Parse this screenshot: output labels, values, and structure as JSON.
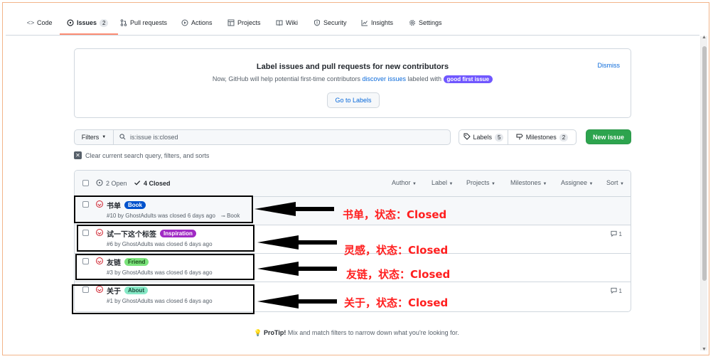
{
  "nav": {
    "tabs": [
      {
        "label": "Code",
        "icon": "code-icon"
      },
      {
        "label": "Issues",
        "icon": "issue-icon",
        "count": "2",
        "selected": true
      },
      {
        "label": "Pull requests",
        "icon": "pull-request-icon"
      },
      {
        "label": "Actions",
        "icon": "play-icon"
      },
      {
        "label": "Projects",
        "icon": "table-icon"
      },
      {
        "label": "Wiki",
        "icon": "book-icon"
      },
      {
        "label": "Security",
        "icon": "shield-icon"
      },
      {
        "label": "Insights",
        "icon": "graph-icon"
      },
      {
        "label": "Settings",
        "icon": "gear-icon"
      }
    ]
  },
  "banner": {
    "title": "Label issues and pull requests for new contributors",
    "text_before": "Now, GitHub will help potential first-time contributors ",
    "link": "discover issues",
    "text_after": " labeled with ",
    "badge": "good first issue",
    "dismiss": "Dismiss",
    "button": "Go to Labels"
  },
  "toolbar": {
    "filters": "Filters",
    "search_value": "is:issue is:closed",
    "labels": "Labels",
    "labels_count": "5",
    "milestones": "Milestones",
    "milestones_count": "2",
    "new_issue": "New issue"
  },
  "clear": "Clear current search query, filters, and sorts",
  "header": {
    "open": "2 Open",
    "closed": "4 Closed",
    "sorts": [
      "Author",
      "Label",
      "Projects",
      "Milestones",
      "Assignee",
      "Sort"
    ]
  },
  "issues": [
    {
      "title": "书单",
      "label": "Book",
      "label_bg": "#0052cc",
      "label_fg": "#ffffff",
      "meta": "#10 by GhostAdults was closed 6 days ago",
      "milestone": "Book",
      "comments": ""
    },
    {
      "title": "试一下这个标签",
      "label": "Inspiration",
      "label_bg": "#a02ac4",
      "label_fg": "#ffffff",
      "meta": "#6 by GhostAdults was closed 6 days ago",
      "milestone": "",
      "comments": "1"
    },
    {
      "title": "友链",
      "label": "Friend",
      "label_bg": "#7be37b",
      "label_fg": "#1a4d1a",
      "meta": "#3 by GhostAdults was closed 6 days ago",
      "milestone": "",
      "comments": ""
    },
    {
      "title": "关于",
      "label": "About",
      "label_bg": "#86e8c6",
      "label_fg": "#1b4d3c",
      "meta": "#1 by GhostAdults was closed 6 days ago",
      "milestone": "",
      "comments": "1"
    }
  ],
  "annotations": [
    "书单，状态：Closed",
    "灵感，状态：Closed",
    "友链，状态：Closed",
    "关于，状态：Closed"
  ],
  "protip": {
    "bold": "ProTip!",
    "text": " Mix and match filters to narrow down what you're looking for."
  }
}
